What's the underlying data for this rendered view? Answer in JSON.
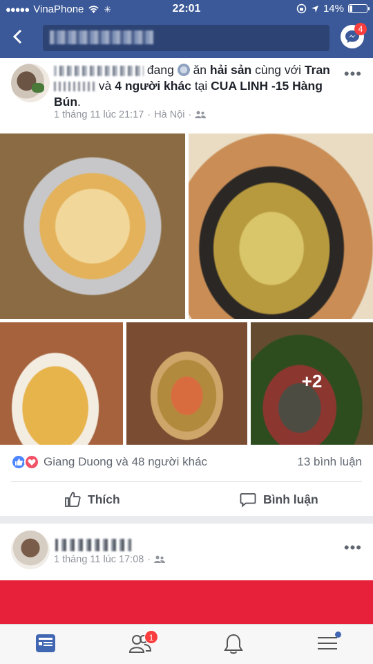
{
  "status_bar": {
    "carrier": "VinaPhone",
    "time": "22:01",
    "battery": "14%",
    "battery_level": 0.14
  },
  "header": {
    "messenger_badge": "4"
  },
  "post": {
    "action_text": "đang",
    "action_verb": "ăn",
    "activity": "hải sản",
    "with_word": "cùng với",
    "tagged_first": "Tran",
    "and_word": "và",
    "others": "4 người khác",
    "at_word": "tại",
    "place_1": "CUA LINH -15",
    "place_2": "Hàng Bún",
    "period": ".",
    "date": "1 tháng 11 lúc 21:17",
    "location": "Hà Nội",
    "extra_photos": "+2",
    "reaction_names": "Giang Duong và 48 người khác",
    "comment_count": "13 bình luận",
    "like_label": "Thích",
    "comment_label": "Bình luận"
  },
  "post2": {
    "date": "1 tháng 11 lúc 17:08"
  },
  "tabbar": {
    "friends_badge": "1"
  },
  "colors": {
    "facebook_blue": "#3b5998",
    "badge_red": "#fa3e3e",
    "like_blue": "#4d86ff",
    "love_red": "#f25268",
    "banner_red": "#e8213a"
  }
}
